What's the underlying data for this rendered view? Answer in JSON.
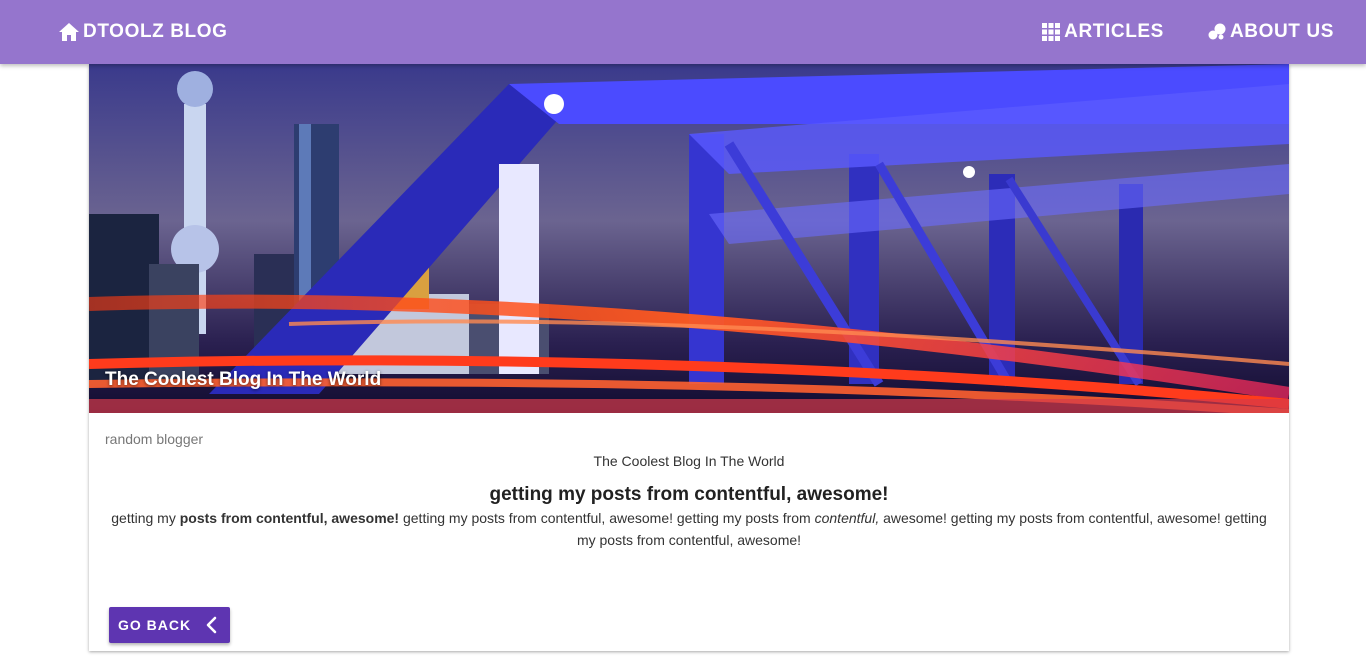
{
  "header": {
    "brand": "DTOOLZ BLOG",
    "brand_icon": "home-icon",
    "nav": [
      {
        "label": "ARTICLES",
        "icon": "grid-icon"
      },
      {
        "label": "ABOUT US",
        "icon": "bubbles-icon"
      }
    ],
    "background_color": "#9575cd"
  },
  "post": {
    "hero_image_description": "night city skyline with illuminated blue steel bridge and red light trails",
    "hero_title": "The Coolest Blog In The World",
    "author": "random blogger",
    "subtitle": "The Coolest Blog In The World",
    "title": "getting my posts from contentful, awesome!",
    "body": {
      "p1": "getting my ",
      "bold": "posts from contentful, awesome!",
      "p2": " getting my posts from contentful, awesome! getting my posts from ",
      "italic": "contentful,",
      "p3": " awesome! getting my posts from contentful, awesome! getting my posts from contentful, awesome!"
    }
  },
  "actions": {
    "back_label": "GO BACK",
    "back_icon": "chevron-left-icon",
    "button_color": "#5e35b1"
  }
}
